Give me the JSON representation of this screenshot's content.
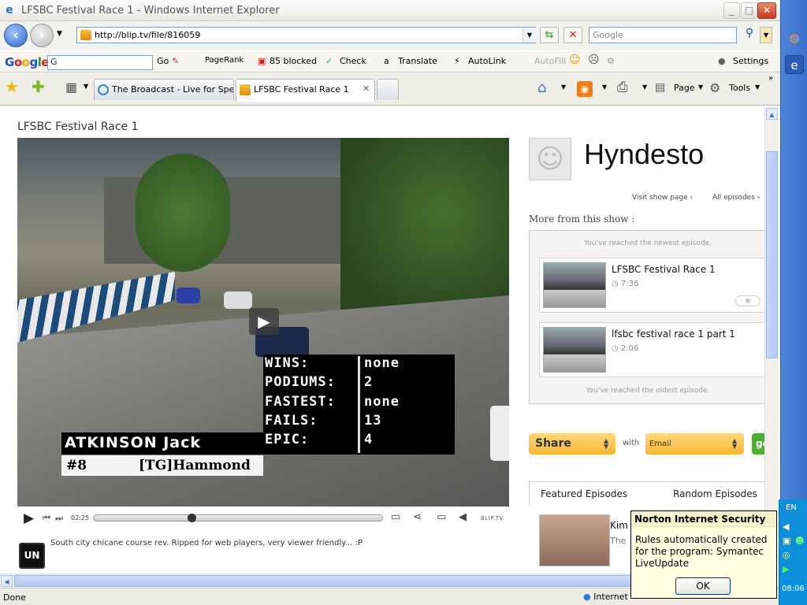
{
  "window": {
    "title": "LFSBC Festival Race 1 - Windows Internet Explorer",
    "minimize": "_",
    "maximize": "□",
    "close": "✕"
  },
  "address": {
    "url": "http://blip.tv/file/816059",
    "search_placeholder": "Google"
  },
  "google_toolbar": {
    "logo": [
      "G",
      "o",
      "o",
      "g",
      "l",
      "e"
    ],
    "search_value": "G",
    "go": "Go",
    "pagerank": "PageRank",
    "blocked": "85 blocked",
    "check": "Check",
    "translate": "Translate",
    "autolink": "AutoLink",
    "autofill": "AutoFill",
    "settings": "Settings"
  },
  "tabs": [
    {
      "label": "The Broadcast - Live for Speed"
    },
    {
      "label": "LFSBC Festival Race 1"
    }
  ],
  "command_bar": {
    "page": "Page",
    "tools": "Tools"
  },
  "page": {
    "title": "LFSBC Festival Race 1",
    "stats": [
      {
        "label": "WINS:",
        "value": "none"
      },
      {
        "label": "PODIUMS:",
        "value": "2"
      },
      {
        "label": "FASTEST:",
        "value": "none"
      },
      {
        "label": "FAILS:",
        "value": "13"
      },
      {
        "label": "EPIC:",
        "value": "4"
      }
    ],
    "driver_name": "ATKINSON Jack",
    "driver_number": "#8",
    "driver_team": "[TG]Hammond",
    "player": {
      "time": "02:25",
      "progress": 0.34,
      "brand": "BLIP.TV"
    },
    "uploader_logo": "UN",
    "description": "South city chicane course rev. Ripped for web players, very viewer friendly... :P"
  },
  "sidebar": {
    "show_name": "Hyndesto",
    "visit_show": "Visit show page ›",
    "all_episodes": "All episodes ›",
    "more_heading": "More from this show :",
    "newest_notice": "You've reached the newest episode.",
    "oldest_notice": "You've reached the oldest episode.",
    "episodes": [
      {
        "title": "LFSBC Festival Race 1",
        "duration": "7:36"
      },
      {
        "title": "lfsbc festival race 1 part 1",
        "duration": "2:06"
      }
    ],
    "share_label": "Share",
    "with_label": "with",
    "share_method": "Email",
    "go_label": "go",
    "featured_tab": "Featured Episodes",
    "random_tab": "Random Episodes",
    "featured_title": "Kim",
    "featured_sub": "The"
  },
  "status": {
    "text": "Done",
    "zone": "Internet"
  },
  "tray": {
    "language": "EN",
    "clock": "08:06"
  },
  "norton": {
    "title": "Norton Internet Security",
    "body": "Rules automatically created for the program: Symantec LiveUpdate",
    "ok": "OK"
  }
}
